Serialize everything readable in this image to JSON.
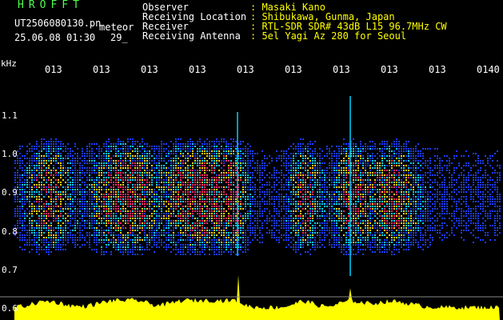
{
  "header": {
    "brand": "HROFFT",
    "file": "UT2506080130.pn",
    "meteor_label": "meteor",
    "datetime": "25.06.08 01:30",
    "meteor_count": "29_"
  },
  "meta": [
    {
      "key": "Observer",
      "value": ": Masaki Kano"
    },
    {
      "key": "Receiving Location",
      "value": ": Shibukawa, Gunma, Japan"
    },
    {
      "key": "Receiver",
      "value": ": RTL-SDR SDR# 43dB L15 96.7MHz CW"
    },
    {
      "key": "Receiving Antenna",
      "value": ": 5el Yagi Az 280 for Seoul"
    }
  ],
  "chart_data": {
    "type": "heatmap",
    "ylabel": "kHz",
    "time_ticks": [
      "013",
      "013",
      "013",
      "013",
      "013",
      "013",
      "013",
      "013",
      "013",
      "0140"
    ],
    "freq_ticks": [
      "1.1",
      "1.0",
      "0.9",
      "0.8",
      "0.7",
      "0.6"
    ],
    "ylim": [
      0.6,
      1.15
    ],
    "signal_band": [
      0.74,
      1.04
    ],
    "colors": {
      "background": "#000000",
      "low": "#1a3cff",
      "mid": "#00d0ff",
      "high": "#ffd000",
      "peak": "#ff2a6a",
      "baseline": "#ffff00"
    }
  }
}
